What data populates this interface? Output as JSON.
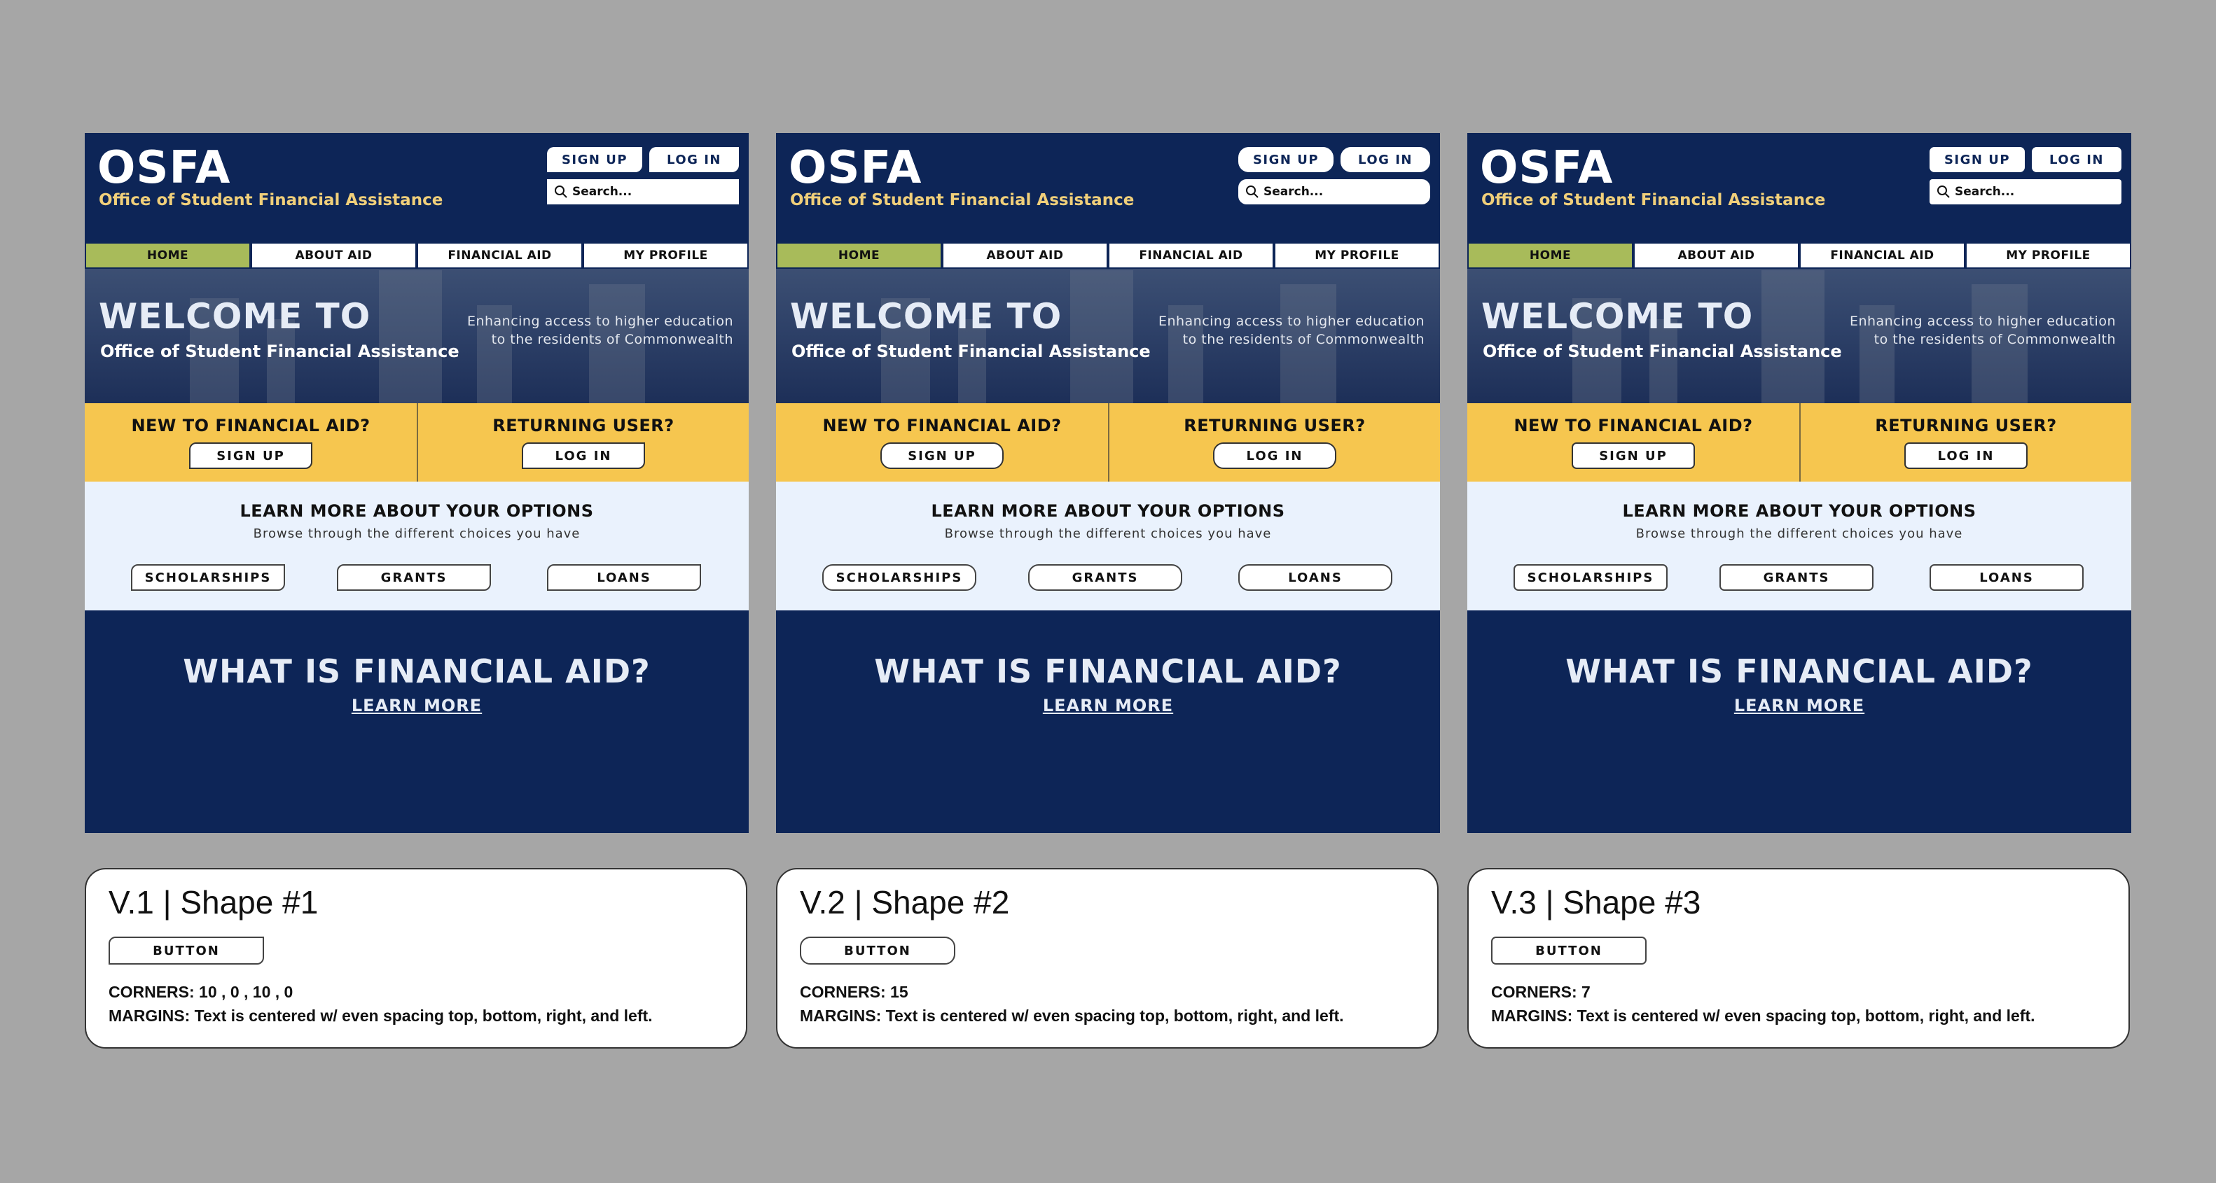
{
  "site": {
    "logo": "OSFA",
    "logo_subtitle": "Office of Student Financial Assistance",
    "signup_label": "SIGN UP",
    "login_label": "LOG IN",
    "search_placeholder": "Search...",
    "nav": [
      "HOME",
      "ABOUT AID",
      "FINANCIAL AID",
      "MY PROFILE"
    ],
    "active_nav": "HOME",
    "hero_title": "WELCOME TO",
    "hero_subtitle": "Office of Student Financial Assistance",
    "hero_tagline_1": "Enhancing access to higher education",
    "hero_tagline_2": "to the residents of Commonwealth",
    "new_user_title": "NEW TO FINANCIAL AID?",
    "new_user_button": "SIGN UP",
    "returning_title": "RETURNING USER?",
    "returning_button": "LOG IN",
    "options_title": "LEARN MORE ABOUT YOUR OPTIONS",
    "options_subtitle": "Browse through the different choices you have",
    "options": [
      "SCHOLARSHIPS",
      "GRANTS",
      "LOANS"
    ],
    "what_title": "WHAT IS FINANCIAL AID?",
    "what_link": "LEARN MORE"
  },
  "cards": [
    {
      "title": "V.1 | Shape #1",
      "button": "BUTTON",
      "corners": "CORNERS: 10 , 0 , 10 , 0",
      "margins": "MARGINS:  Text is centered w/ even spacing top, bottom, right, and left."
    },
    {
      "title": "V.2 | Shape #2",
      "button": "BUTTON",
      "corners": "CORNERS: 15",
      "margins": "MARGINS:  Text is centered w/ even spacing top, bottom, right, and left."
    },
    {
      "title": "V.3 | Shape #3",
      "button": "BUTTON",
      "corners": "CORNERS: 7",
      "margins": "MARGINS:  Text is centered w/ even spacing top, bottom, right, and left."
    }
  ],
  "colors": {
    "navy": "#0d2557",
    "gold_text": "#f0cf7a",
    "nav_active": "#a8bb5a",
    "yellow_band": "#f6c64f",
    "light_band": "#eaf2fd",
    "page_bg": "#a6a6a6"
  },
  "icons": {
    "search": "magnifier-icon"
  }
}
